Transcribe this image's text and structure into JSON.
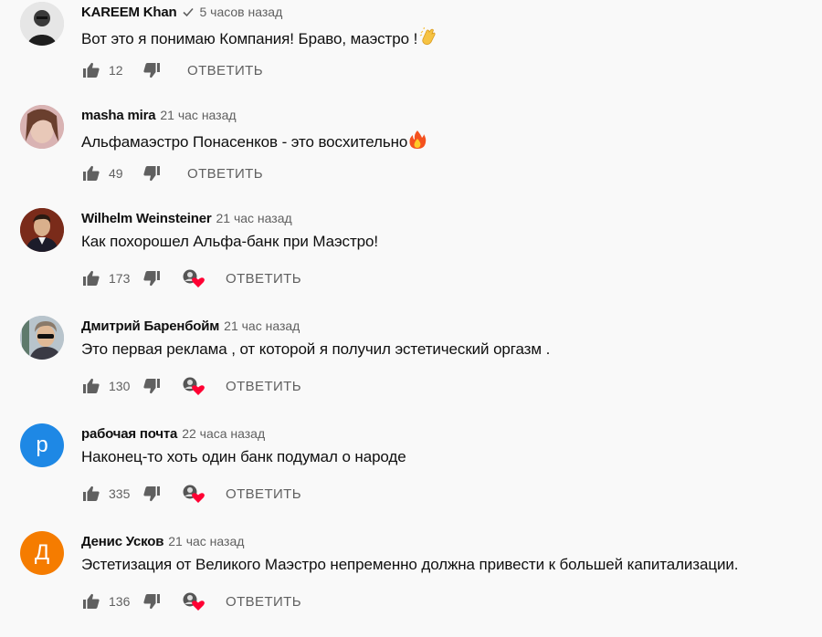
{
  "comments": [
    {
      "author": "KAREEM Khan",
      "verified": true,
      "time": "5 часов назад",
      "text": "Вот это я понимаю Компания! Браво, маэстро !",
      "emoji": "clapping-hands",
      "likes": "12",
      "hearted": false,
      "reply_label": "ОТВЕТИТЬ",
      "avatar": {
        "kind": "photo",
        "bg": "#d8d8d8"
      }
    },
    {
      "author": "masha mira",
      "verified": false,
      "time": "21 час назад",
      "text": "Альфамаэстро Понасенков - это восхительно",
      "emoji": "fire",
      "likes": "49",
      "hearted": false,
      "reply_label": "ОТВЕТИТЬ",
      "avatar": {
        "kind": "photo",
        "bg": "#c9a0a4"
      }
    },
    {
      "author": "Wilhelm Weinsteiner",
      "verified": false,
      "time": "21 час назад",
      "text": "Как похорошел Альфа-банк при Маэстро!",
      "emoji": "",
      "likes": "173",
      "hearted": true,
      "reply_label": "ОТВЕТИТЬ",
      "avatar": {
        "kind": "photo",
        "bg": "#6b2a1c"
      }
    },
    {
      "author": "Дмитрий Баренбойм",
      "verified": false,
      "time": "21 час назад",
      "text": "Это первая реклама , от которой я получил эстетический оргазм .",
      "emoji": "",
      "likes": "130",
      "hearted": true,
      "reply_label": "ОТВЕТИТЬ",
      "avatar": {
        "kind": "photo",
        "bg": "#aeb8c0"
      }
    },
    {
      "author": "рабочая почта",
      "verified": false,
      "time": "22 часа назад",
      "text": "Наконец-то хоть один банк подумал о народе",
      "emoji": "",
      "likes": "335",
      "hearted": true,
      "reply_label": "ОТВЕТИТЬ",
      "avatar": {
        "kind": "letter",
        "letter": "р",
        "bg": "#1e88e5"
      }
    },
    {
      "author": "Денис Усков",
      "verified": false,
      "time": "21 час назад",
      "text": "Эстетизация от Великого Маэстро непременно должна привести к большей капитализации.",
      "emoji": "",
      "likes": "136",
      "hearted": true,
      "reply_label": "ОТВЕТИТЬ",
      "avatar": {
        "kind": "letter",
        "letter": "Д",
        "bg": "#f57c00"
      }
    }
  ]
}
